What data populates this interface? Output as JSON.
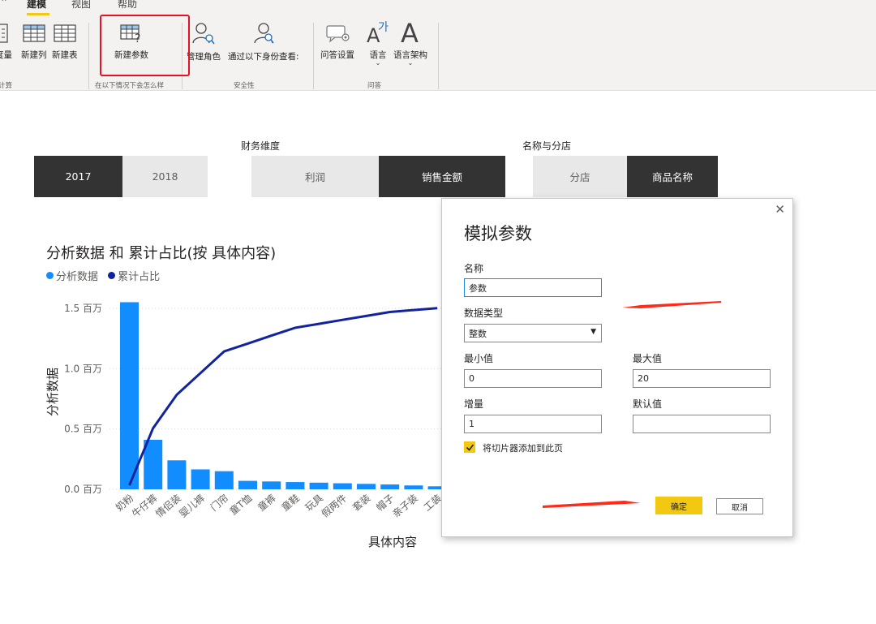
{
  "ribbon": {
    "tabs": [
      {
        "label": "建模",
        "active": true
      },
      {
        "label": "视图",
        "active": false
      },
      {
        "label": "帮助",
        "active": false
      }
    ],
    "buttons": {
      "new_measure": "度量",
      "new_column": "新建列",
      "new_table": "新建表",
      "new_parameter": "新建参数",
      "manage_roles": "管理角色",
      "view_as_roles": "通过以下身份查看:",
      "qa_setup": "问答设置",
      "language": "语言",
      "linguistic_schema": "语言架构"
    },
    "groups": {
      "calculations": "计算",
      "what_if": "在以下情况下会怎么样",
      "security": "安全性",
      "qa": "问答"
    }
  },
  "slicers": {
    "year": {
      "options": [
        {
          "label": "2017",
          "selected": true
        },
        {
          "label": "2018",
          "selected": false
        }
      ]
    },
    "finance": {
      "title": "财务维度",
      "options": [
        {
          "label": "利润",
          "selected": false
        },
        {
          "label": "销售金额",
          "selected": true
        }
      ]
    },
    "name_store": {
      "title": "名称与分店",
      "options": [
        {
          "label": "分店",
          "selected": false
        },
        {
          "label": "商品名称",
          "selected": true
        }
      ]
    }
  },
  "chart": {
    "title": "分析数据 和 累计占比(按 具体内容)",
    "legend": [
      {
        "name": "分析数据",
        "color": "#118dff"
      },
      {
        "name": "累计占比",
        "color": "#12239e"
      }
    ]
  },
  "chart_data": {
    "type": "bar",
    "title": "分析数据 和 累计占比(按 具体内容)",
    "xlabel": "具体内容",
    "ylabel": "分析数据",
    "ylim": [
      0,
      1600000
    ],
    "yticks": [
      "0.0 百万",
      "0.5 百万",
      "1.0 百万",
      "1.5 百万"
    ],
    "categories": [
      "奶粉",
      "牛仔裤",
      "情侣装",
      "婴儿裤",
      "门帘",
      "童T恤",
      "童裤",
      "童鞋",
      "玩具",
      "假两件",
      "套装",
      "帽子",
      "亲子装",
      "工装"
    ],
    "series": [
      {
        "name": "分析数据",
        "kind": "bar",
        "color": "#118dff",
        "values": [
          1550000,
          410000,
          240000,
          165000,
          150000,
          70000,
          65000,
          60000,
          55000,
          50000,
          45000,
          40000,
          32000,
          25000
        ]
      },
      {
        "name": "累计占比",
        "kind": "line",
        "color": "#12239e",
        "values": [
          0.02,
          0.31,
          0.48,
          0.59,
          0.7,
          0.74,
          0.78,
          0.82,
          0.84,
          0.86,
          0.88,
          0.9,
          0.91,
          0.92
        ]
      }
    ],
    "grid": true
  },
  "dialog": {
    "title": "模拟参数",
    "close_glyph": "✕",
    "name_label": "名称",
    "name_value": "参数",
    "type_label": "数据类型",
    "type_value": "整数",
    "min_label": "最小值",
    "min_value": "0",
    "max_label": "最大值",
    "max_value": "20",
    "inc_label": "增量",
    "inc_value": "1",
    "default_label": "默认值",
    "default_value": "",
    "checkbox_label": "将切片器添加到此页",
    "checkbox_checked": true,
    "ok_label": "确定",
    "cancel_label": "取消"
  },
  "annotation_color": "#ff2a1a"
}
